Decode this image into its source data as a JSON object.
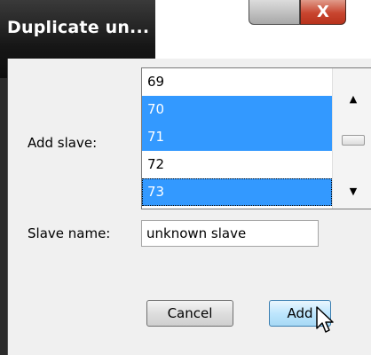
{
  "dialog": {
    "title": "Duplicate un...",
    "close_glyph": "X",
    "add_slave_label": "Add slave:",
    "slave_list": {
      "items": [
        {
          "label": "69",
          "selected": false
        },
        {
          "label": "70",
          "selected": true
        },
        {
          "label": "71",
          "selected": true
        },
        {
          "label": "72",
          "selected": false
        },
        {
          "label": "73",
          "selected": true,
          "focused": true
        }
      ],
      "scroll_up_icon": "up-triangle-icon",
      "scroll_down_icon": "down-triangle-icon"
    },
    "slave_name_label": "Slave name:",
    "slave_name_value": "unknown slave",
    "cancel_label": "Cancel",
    "add_label": "Add"
  },
  "colors": {
    "selection": "#3399ff",
    "title_bar": "#161616",
    "close_button": "#c8452f",
    "default_button": "#bee6fd"
  }
}
